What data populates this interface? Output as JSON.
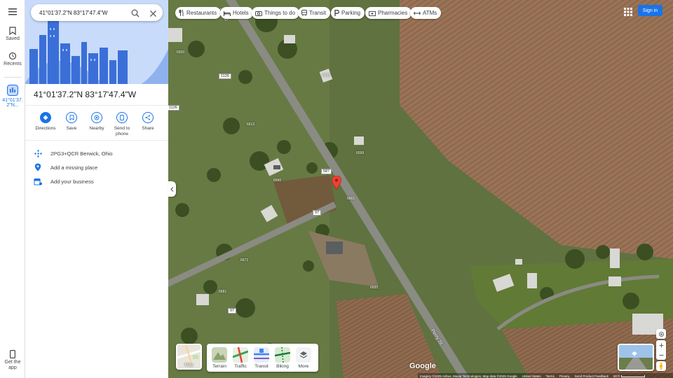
{
  "search": {
    "value": "41°01'37.2\"N 83°17'47.4\"W"
  },
  "rail": {
    "saved": "Saved",
    "recents": "Recents",
    "current": "41°01'37.2\"N...",
    "get_app": "Get the app"
  },
  "place": {
    "title": "41°01'37.2\"N 83°17'47.4\"W",
    "actions": [
      "Directions",
      "Save",
      "Nearby",
      "Send to phone",
      "Share"
    ],
    "plus_code": "2PG3+QCR Berwick, Ohio",
    "add_missing": "Add a missing place",
    "add_business": "Add your business"
  },
  "chips": [
    "Restaurants",
    "Hotels",
    "Things to do",
    "Transit",
    "Parking",
    "Pharmacies",
    "ATMs"
  ],
  "header": {
    "sign_in": "Sign in"
  },
  "layers": {
    "mini_label": "Map",
    "items": [
      "Terrain",
      "Traffic",
      "Transit",
      "Biking",
      "More"
    ]
  },
  "map": {
    "road_labels": [
      "1126",
      "1126",
      "587",
      "97",
      "97"
    ],
    "street_names": [
      "Perry St",
      "CR 30"
    ],
    "addresses": [
      "6550",
      "6630",
      "6612",
      "6599",
      "6590",
      "6661",
      "6671",
      "6681",
      "6650"
    ]
  },
  "footer": {
    "imagery": "Imagery ©2025 Airbus, Maxar Technologies, Map data ©2025 Google",
    "country": "United States",
    "terms": "Terms",
    "privacy": "Privacy",
    "feedback": "Send Product Feedback",
    "scale": "50 ft"
  },
  "colors": {
    "accent": "#1a73e8",
    "pin": "#ea4335"
  }
}
